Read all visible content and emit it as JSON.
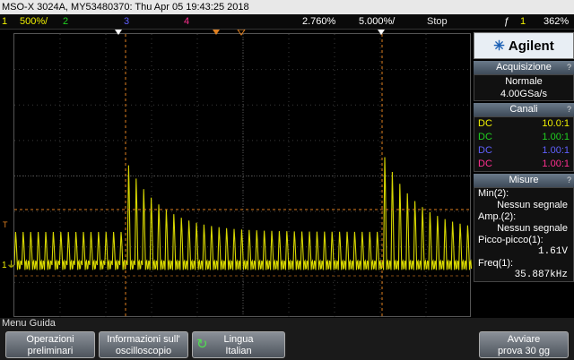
{
  "title": "MSO-X 3024A, MY53480370: Thu Apr 05 19:43:25 2018",
  "status": {
    "ch1_num": "1",
    "ch1_scale": "500%/",
    "ch2_num": "2",
    "ch3_num": "3",
    "ch4_num": "4",
    "time_delay": "2.760%",
    "time_scale": "5.000%/",
    "run_state": "Stop",
    "trigger_icon": "ƒ",
    "trigger_ch": "1",
    "trigger_level": "362%"
  },
  "panel": {
    "brand": "Agilent",
    "acq_title": "Acquisizione",
    "acq_mode": "Normale",
    "acq_rate": "4.00GSa/s",
    "channels_title": "Canali",
    "channels": [
      {
        "coupling": "DC",
        "probe": "10.0:1",
        "color": "#f0f000"
      },
      {
        "coupling": "DC",
        "probe": "1.00:1",
        "color": "#20d020"
      },
      {
        "coupling": "DC",
        "probe": "1.00:1",
        "color": "#6060ff"
      },
      {
        "coupling": "DC",
        "probe": "1.00:1",
        "color": "#ff3090"
      }
    ],
    "meas_title": "Misure",
    "meas": [
      {
        "label": "Min(2):",
        "value": "Nessun segnale"
      },
      {
        "label": "Amp.(2):",
        "value": "Nessun segnale"
      },
      {
        "label": "Picco-picco(1):",
        "value": "1.61V"
      },
      {
        "label": "Freq(1):",
        "value": "35.887kHz"
      }
    ]
  },
  "menu": {
    "title": "Menu Guida",
    "k1_l1": "Operazioni",
    "k1_l2": "preliminari",
    "k2_l1": "Informazioni sull'",
    "k2_l2": "oscilloscopio",
    "k3_l1": "Lingua",
    "k3_l2": "Italian",
    "k4_l1": "Avviare",
    "k4_l2": "prova 30 gg"
  },
  "colors": {
    "ch1": "#f0f000",
    "ch2": "#20d020",
    "ch3": "#6060ff",
    "ch4": "#ff3090",
    "cursor": "#e08020"
  }
}
